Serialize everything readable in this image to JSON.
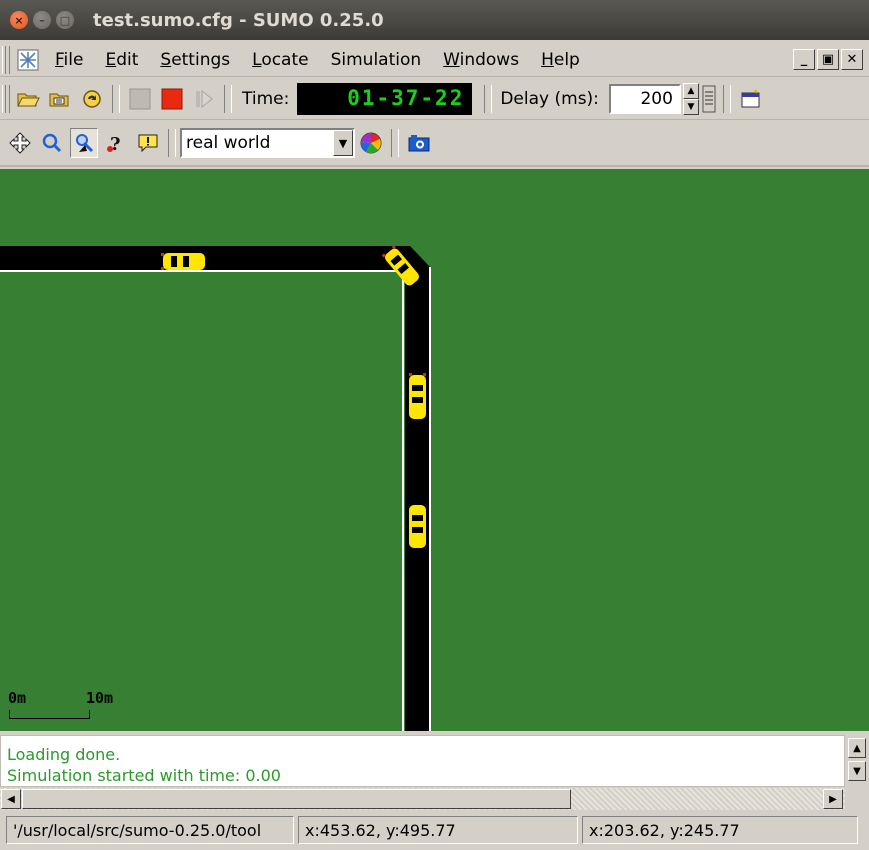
{
  "window": {
    "title": "test.sumo.cfg - SUMO 0.25.0"
  },
  "menu": {
    "items": [
      {
        "label": "File",
        "mnemonic": "F",
        "rest": "ile"
      },
      {
        "label": "Edit",
        "mnemonic": "E",
        "rest": "dit"
      },
      {
        "label": "Settings",
        "mnemonic": "S",
        "rest": "ettings"
      },
      {
        "label": "Locate",
        "mnemonic": "L",
        "rest": "ocate"
      },
      {
        "label": "Simulation",
        "mnemonic": "",
        "rest": "Simulation"
      },
      {
        "label": "Windows",
        "mnemonic": "W",
        "rest": "indows"
      },
      {
        "label": "Help",
        "mnemonic": "H",
        "rest": "elp"
      }
    ]
  },
  "toolbar": {
    "time_label": "Time:",
    "time_value": "01-37-22",
    "delay_label": "Delay (ms):",
    "delay_value": "200"
  },
  "view_toolbar": {
    "scheme_selected": "real world"
  },
  "canvas": {
    "scale_start": "0m",
    "scale_end": "10m",
    "colors": {
      "grass": "#367f33",
      "road": "#000000",
      "vehicle": "#ffe600"
    }
  },
  "log": {
    "lines": [
      "Loading done.",
      "Simulation started with time: 0.00"
    ]
  },
  "status": {
    "path": "'/usr/local/src/sumo-0.25.0/tool",
    "cursor_net": "x:453.62, y:495.77",
    "cursor_geo": "x:203.62, y:245.77"
  }
}
